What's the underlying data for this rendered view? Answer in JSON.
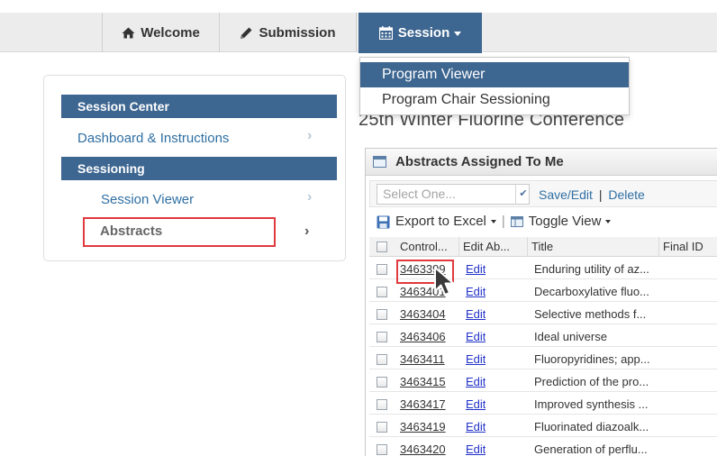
{
  "navbar": {
    "items": [
      {
        "label": "Welcome",
        "icon": "home-icon"
      },
      {
        "label": "Submission",
        "icon": "pencil-icon"
      },
      {
        "label": "Session",
        "icon": "calendar-icon"
      }
    ]
  },
  "dropdown": {
    "items": [
      {
        "label": "Program Viewer",
        "active": true
      },
      {
        "label": "Program Chair Sessioning",
        "active": false
      }
    ]
  },
  "conference_title": "25th Winter Fluorine Conference",
  "left_panel": {
    "section1_title": "Session Center",
    "dashboard_link": "Dashboard & Instructions",
    "section2_title": "Sessioning",
    "session_viewer": "Session Viewer",
    "abstracts": "Abstracts"
  },
  "grid": {
    "title": "Abstracts Assigned To Me",
    "select_placeholder": "Select One...",
    "save_edit": "Save/Edit",
    "link_separator": "|",
    "delete": "Delete",
    "export": "Export to Excel",
    "toggle": "Toggle View",
    "columns": [
      "Control...",
      "Edit Ab...",
      "Title",
      "Final ID"
    ],
    "rows": [
      {
        "id": "3463399",
        "edit": "Edit",
        "title": "Enduring utility of az..."
      },
      {
        "id": "3463401",
        "edit": "Edit",
        "title": "Decarboxylative fluo..."
      },
      {
        "id": "3463404",
        "edit": "Edit",
        "title": "Selective methods f..."
      },
      {
        "id": "3463406",
        "edit": "Edit",
        "title": "Ideal universe"
      },
      {
        "id": "3463411",
        "edit": "Edit",
        "title": "Fluoropyridines; app..."
      },
      {
        "id": "3463415",
        "edit": "Edit",
        "title": "Prediction of the pro..."
      },
      {
        "id": "3463417",
        "edit": "Edit",
        "title": "Improved synthesis ..."
      },
      {
        "id": "3463419",
        "edit": "Edit",
        "title": "Fluorinated diazoalk..."
      },
      {
        "id": "3463420",
        "edit": "Edit",
        "title": "Generation of perflu..."
      }
    ]
  },
  "colors": {
    "nav_active": "#3d6690",
    "section_header": "#3d6690",
    "link": "#2f6fa3",
    "highlight": "#e0393e"
  }
}
